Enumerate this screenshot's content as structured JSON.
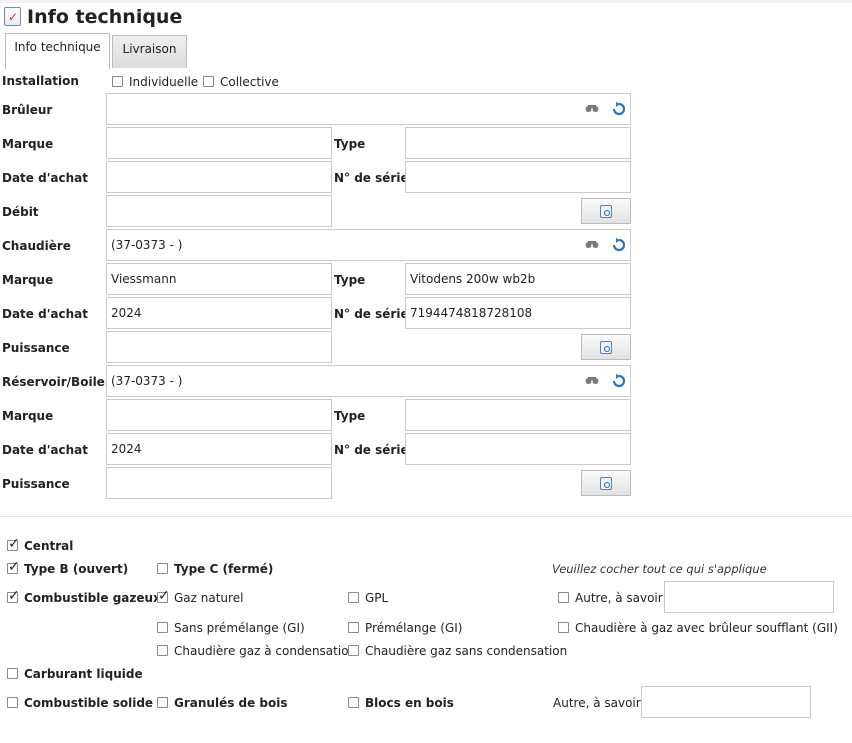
{
  "header": {
    "title": "Info technique"
  },
  "tabs": [
    {
      "label": "Info technique"
    },
    {
      "label": "Livraison"
    }
  ],
  "installation": {
    "label": "Installation",
    "opt1": "Individuelle",
    "opt2": "Collective"
  },
  "bruleur": {
    "label": "Brûleur",
    "value": "",
    "marque_label": "Marque",
    "marque": "",
    "type_label": "Type",
    "type": "",
    "date_label": "Date d'achat",
    "date": "",
    "serie_label": "N° de série",
    "serie": "",
    "debit_label": "Débit",
    "debit": ""
  },
  "chaudiere": {
    "label": "Chaudière",
    "value": "(37-0373 - )",
    "marque_label": "Marque",
    "marque": "Viessmann",
    "type_label": "Type",
    "type": "Vitodens 200w wb2b",
    "date_label": "Date d'achat",
    "date": "2024",
    "serie_label": "N° de série",
    "serie": "7194474818728108",
    "puissance_label": "Puissance",
    "puissance": ""
  },
  "reservoir": {
    "label": "Réservoir/Boiler",
    "value": "(37-0373 - )",
    "marque_label": "Marque",
    "marque": "",
    "type_label": "Type",
    "type": "",
    "date_label": "Date d'achat",
    "date": "2024",
    "serie_label": "N° de série",
    "serie": "",
    "puissance_label": "Puissance",
    "puissance": ""
  },
  "options": {
    "central": "Central",
    "typeB": "Type B (ouvert)",
    "typeC": "Type C (fermé)",
    "hint": "Veuillez cocher tout ce qui s'applique",
    "gazeux": "Combustible gazeux",
    "gaz_naturel": "Gaz naturel",
    "gpl": "GPL",
    "autre1": "Autre, à savoir:",
    "sans_premelange": "Sans prémélange (GI)",
    "premelange": "Prémélange (GI)",
    "souffle": "Chaudière à gaz avec brûleur soufflant (GII)",
    "condensation": "Chaudière gaz à condensation",
    "sans_condensation": "Chaudière gaz sans condensation",
    "liquide": "Carburant liquide",
    "solide": "Combustible solide",
    "granules": "Granulés de bois",
    "blocs": "Blocs en bois",
    "autre2": "Autre, à savoir:"
  }
}
